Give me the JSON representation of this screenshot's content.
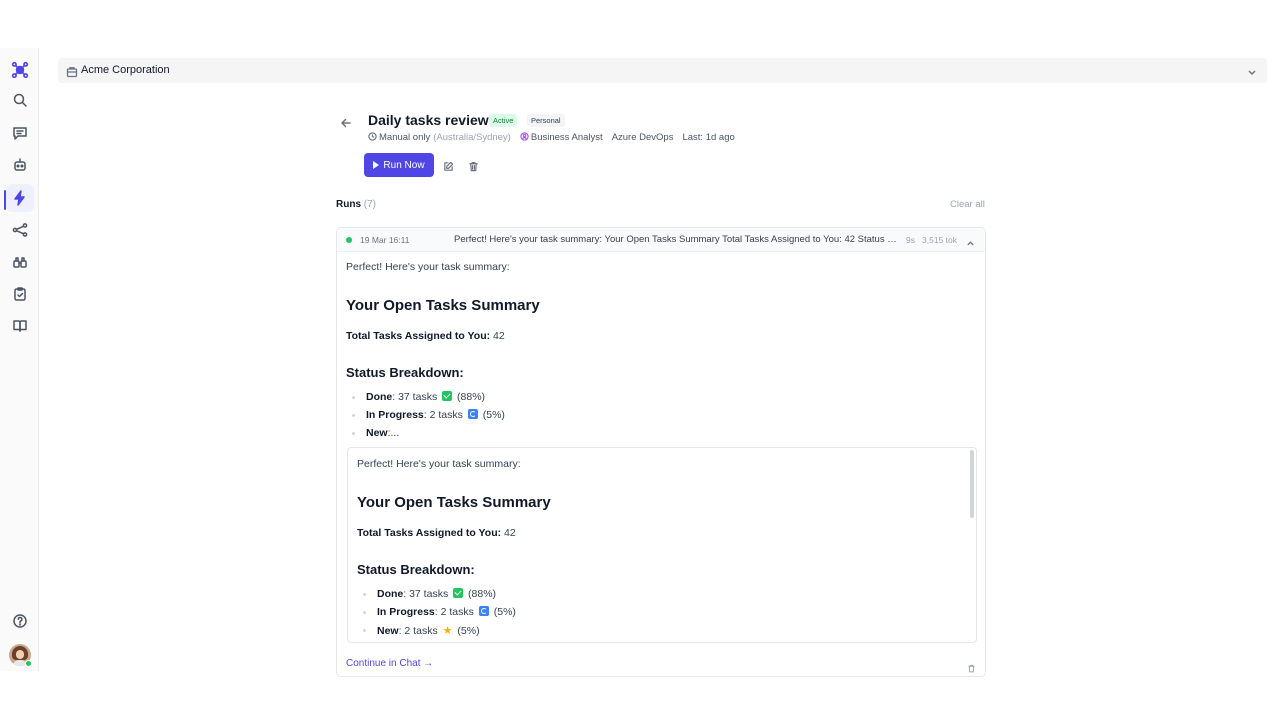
{
  "org": {
    "name": "Acme Corporation"
  },
  "automation": {
    "title": "Daily tasks review",
    "status_badge": "Active",
    "scope_badge": "Personal",
    "schedule": "Manual only",
    "timezone": "(Australia/Sydney)",
    "role": "Business Analyst",
    "integration": "Azure DevOps",
    "last_run": "Last: 1d ago",
    "run_now_label": "Run Now"
  },
  "runs": {
    "label": "Runs",
    "count": "(7)",
    "clear_all_label": "Clear all",
    "items": [
      {
        "date": "19 Mar 16:11",
        "preview": "Perfect! Here's your task summary: Your Open Tasks Summary Total Tasks Assigned to You: 42 Status Breakdown: Done: 37 tasks (88%) In Progress: 2 tasks (5%) New: 2 tasks (5%)",
        "duration": "9s",
        "tokens": "3,515 tok",
        "status_color": "#22c55e"
      }
    ]
  },
  "summary": {
    "intro": "Perfect! Here's your task summary:",
    "heading": "Your Open Tasks Summary",
    "total_label": "Total Tasks Assigned to You:",
    "total_value": "42",
    "breakdown_heading": "Status Breakdown:",
    "done_label": "Done",
    "done_value": ": 37 tasks",
    "done_pct": "(88%)",
    "inprogress_label": "In Progress",
    "inprogress_value": ": 2 tasks",
    "inprogress_pct": "(5%)",
    "new_label": "New",
    "new_truncated": ":...",
    "new_value": ": 2 tasks",
    "new_pct": "(5%)"
  },
  "continue_label": "Continue in Chat →",
  "colors": {
    "accent": "#4f46e5",
    "success": "#22c55e"
  },
  "icons": {
    "sidebar": [
      "logo-icon",
      "search-icon",
      "chat-icon",
      "bot-icon",
      "lightning-icon",
      "share-icon",
      "binoculars-icon",
      "clipboard-check-icon",
      "book-icon",
      "help-icon"
    ]
  }
}
